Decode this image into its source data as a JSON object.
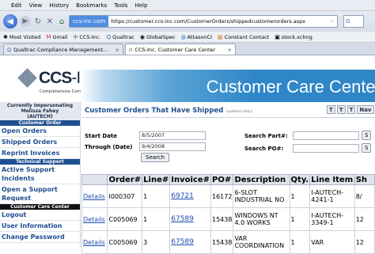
{
  "browser": {
    "menu": [
      "Edit",
      "View",
      "History",
      "Bookmarks",
      "Tools",
      "Help"
    ],
    "url": "https://customer.ccs-inc.com/CustomerOrders/shippedcustomerorders.aspx",
    "site_badge": "ccs-inc.com",
    "search_placeholder": "G",
    "bookmarks": [
      "Most Visited",
      "Gmail",
      "CCS-Inc.",
      "Qualtrac",
      "GlobalSpec",
      "AttasonCI",
      "Constant Contact",
      "stock.xchng"
    ],
    "tabs": [
      {
        "label": "Qualtrac Compliance Management..."
      },
      {
        "label": "CCS-Inc. Customer Care Center"
      }
    ]
  },
  "header": {
    "logo_main": "CCS",
    "logo_suffix": "-Inc.",
    "tagline": "Comprehensive Computer Solutions",
    "banner_title": "Customer Care Center"
  },
  "sidebar": {
    "impersonating_title": "Currently Impersonating",
    "impersonating_name": "Melissa Fahey",
    "impersonating_company": "(AUTECH)",
    "customer_order_heading": "Customer Order",
    "links_orders": [
      "Open Orders",
      "Shipped Orders",
      "Reprint Invoices"
    ],
    "technical_support_heading": "Technical Support",
    "links_support": [
      "Active Support Incidents",
      "Open a Support Request"
    ],
    "care_center_heading": "Customer Care Center",
    "links_care": [
      "Logout",
      "User Information",
      "Change Password"
    ]
  },
  "main": {
    "title": "Customer Orders That Have Shipped",
    "title_note": "(updated daily)",
    "tools": [
      "T",
      "T",
      "T",
      "Nav"
    ],
    "start_date_label": "Start Date",
    "start_date_value": "8/5/2007",
    "through_date_label": "Through (Date)",
    "through_date_value": "9/4/2008",
    "search_button": "Search",
    "part_label": "Search Part#:",
    "po_label": "Search PO#:",
    "right_button_1": "S",
    "right_button_2": "S"
  },
  "table": {
    "headers": [
      "",
      "Order#",
      "Line#",
      "Invoice#",
      "PO#",
      "Description",
      "Qty.",
      "Line Item",
      "Sh"
    ],
    "rows": [
      [
        "Details",
        "I000307",
        "1",
        "69721",
        "16172",
        "6-SLOT INDUSTRIAL NO",
        "1",
        "I-AUTECH-4241-1",
        "8/"
      ],
      [
        "Details",
        "C005069",
        "1",
        "67589",
        "15438",
        "WINDOWS NT 4.0 WORKS",
        "1",
        "I-AUTECH-3349-1",
        "12"
      ],
      [
        "Details",
        "C005069",
        "3",
        "67589",
        "15438",
        "VAR COORDINATION",
        "1",
        "VAR",
        "12"
      ]
    ]
  }
}
